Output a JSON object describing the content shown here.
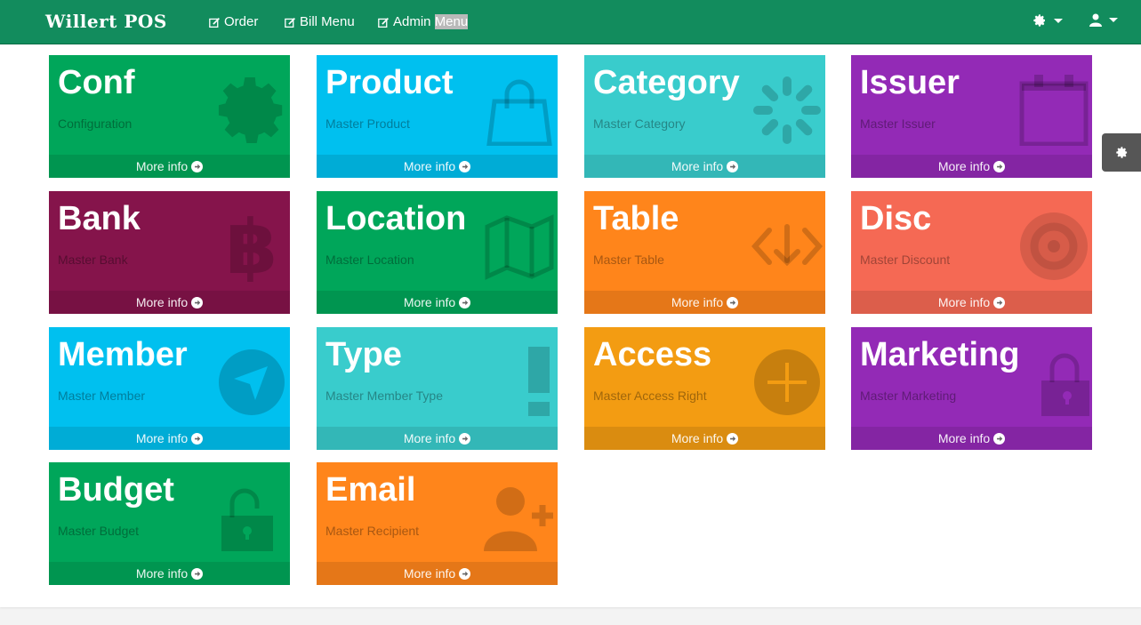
{
  "nav": {
    "brand": "Willert POS",
    "links": [
      {
        "label": "Order"
      },
      {
        "label": "Bill Menu"
      },
      {
        "label_a": "Admin ",
        "label_b": "Menu"
      }
    ]
  },
  "more_info_label": "More info",
  "tiles": [
    {
      "title": "Conf",
      "subtitle": "Configuration",
      "color": "#00a65a",
      "icon": "gear-icon"
    },
    {
      "title": "Product",
      "subtitle": "Master Product",
      "color": "#00c0ef",
      "icon": "shopping-bag-icon"
    },
    {
      "title": "Category",
      "subtitle": "Master Category",
      "color": "#39cccc",
      "icon": "spinner-icon"
    },
    {
      "title": "Issuer",
      "subtitle": "Master Issuer",
      "color": "#932ab6",
      "icon": "calendar-icon"
    },
    {
      "title": "Bank",
      "subtitle": "Master Bank",
      "color": "#85144b",
      "icon": "bitcoin-icon"
    },
    {
      "title": "Location",
      "subtitle": "Master Location",
      "color": "#00a65a",
      "icon": "map-icon"
    },
    {
      "title": "Table",
      "subtitle": "Master Table",
      "color": "#ff851b",
      "icon": "code-fork-icon"
    },
    {
      "title": "Disc",
      "subtitle": "Master Discount",
      "color": "#f56954",
      "icon": "bullseye-icon"
    },
    {
      "title": "Member",
      "subtitle": "Master Member",
      "color": "#00c0ef",
      "icon": "location-arrow-icon"
    },
    {
      "title": "Type",
      "subtitle": "Master Member Type",
      "color": "#39cccc",
      "icon": "exclamation-icon"
    },
    {
      "title": "Access",
      "subtitle": "Master Access Right",
      "color": "#f39c12",
      "icon": "plus-circle-icon"
    },
    {
      "title": "Marketing",
      "subtitle": "Master Marketing",
      "color": "#932ab6",
      "icon": "lock-icon"
    },
    {
      "title": "Budget",
      "subtitle": "Master Budget",
      "color": "#00a65a",
      "icon": "unlock-icon"
    },
    {
      "title": "Email",
      "subtitle": "Master Recipient",
      "color": "#ff851b",
      "icon": "user-plus-icon"
    }
  ]
}
